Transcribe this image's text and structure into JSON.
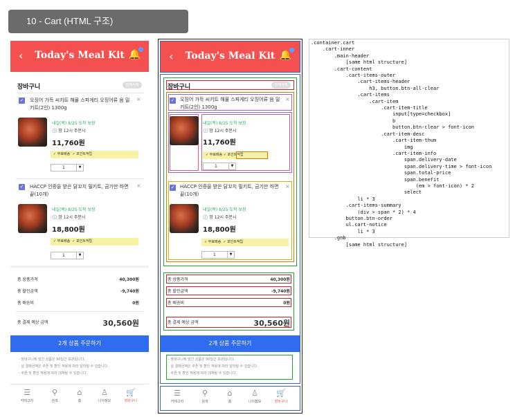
{
  "tag": "10 - Cart (HTML 구조)",
  "header": {
    "title": "Today's Meal Kit",
    "back": "‹",
    "bell": "🔔"
  },
  "cart": {
    "title": "장바구니",
    "clear": "전체삭제",
    "close": "×",
    "check": "✓"
  },
  "items": [
    {
      "title": "오징어 가득 씨키트 해물 스파게티 오징어류 음 밀키트(2인) 1300g",
      "delivery_date": "내일(목) 8/25 도착 보장",
      "delivery_time": "🕔 밤 12시 주문시",
      "price": "11,760원",
      "benefits": [
        "✓ 무료배송",
        "✓ 포인트적립"
      ],
      "qty": "1",
      "arrow": "▼"
    },
    {
      "title": "HACCP 인증을 받은 닭꼬치 밀키트, 금기만 하면 끝(10개)",
      "delivery_date": "내일(목) 8/25 도착 보장",
      "delivery_time": "🕔 밤 12시 주문시",
      "price": "18,800원",
      "benefits": [
        "✓ 무료배송",
        "✓ 포인트적립"
      ],
      "qty": "1",
      "arrow": "▼"
    }
  ],
  "summary": {
    "product_label": "총 상품가격",
    "product_value": "40,300원",
    "discount_label": "총 할인금액",
    "discount_value": "-9,740원",
    "shipping_label": "총 배송비",
    "shipping_value": "0원",
    "total_label": "총 결제 예상 금액",
    "total_value": "30,560원"
  },
  "order_button": "2개 상품 주문하기",
  "notices": [
    "- 장바구니에 담긴 상품은 90일간 보관됩니다.",
    "- 실 결제금액은 쿠폰 및 할인 적용에 따라 달라질 수 있습니다.",
    "- 쿠폰 및 할인 적용에 따라 대체될 수 있습니다."
  ],
  "gnb": [
    {
      "label": "카테고리",
      "icon": "☰"
    },
    {
      "label": "검색",
      "icon": "⚲"
    },
    {
      "label": "홈",
      "icon": "⌂"
    },
    {
      "label": "나의정보",
      "icon": "♙"
    },
    {
      "label": "장바구니",
      "icon": "🛒"
    }
  ],
  "code_lines": [
    ".container.cart",
    "    .cart-inner",
    "        .main-header",
    "            [same html structure]",
    "        .cart-content",
    "            .cart-items-outer",
    "                .cart-items-header",
    "                    h3, button.btn-all-clear",
    "                .cart-items",
    "                    .cart-item",
    "                        .cart-item-title",
    "                            input[type=checkbox]",
    "                            b",
    "                            button.btn-clear > font-icon",
    "                        .cart-item-desc",
    "                            .cart-item-thum",
    "                                img",
    "                            .cart-item-info",
    "                                span.delivery-date",
    "                                span.delivery-time > font-icon",
    "                                span.total-price",
    "                                span.benefit",
    "                                    (em > font-icon) * 2",
    "                                select",
    "                li * 3",
    "            .cart-items-summary",
    "                (div > span * 2) * 4",
    "            button.btn-order",
    "            ul.cart-notice",
    "                li * 3",
    "        .gnb",
    "            [same html structure]"
  ],
  "colors": {
    "header": "#f4504f",
    "order": "#2f6cf0",
    "benefit": "#f7f2a5",
    "delivery": "#2fa96a"
  }
}
